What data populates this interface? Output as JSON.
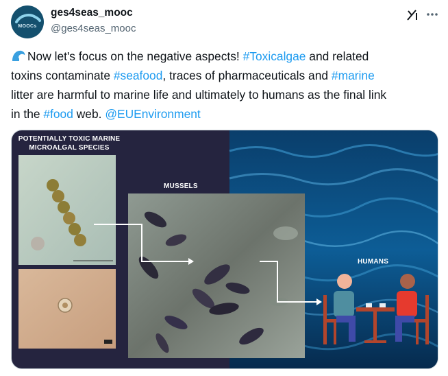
{
  "author": {
    "display_name": "ges4seas_mooc",
    "handle": "@ges4seas_mooc",
    "avatar_label": "MOOCs"
  },
  "tweet": {
    "line1": {
      "t1": "Now let's focus on the negative aspects! ",
      "h1": "#Toxicalgae",
      "t2": " and related"
    },
    "line2": {
      "t1": "toxins contaminate ",
      "h1": "#seafood",
      "t2": ", traces of pharmaceuticals and ",
      "h2": "#marine"
    },
    "line3": {
      "t1": "litter are harmful to marine life and ultimately to humans as the final link"
    },
    "line4": {
      "t1": "in the ",
      "h1": "#food",
      "t2": " web. ",
      "m1": "@EUEnvironment"
    }
  },
  "media": {
    "species_label_1": "POTENTIALLY TOXIC MARINE",
    "species_label_2": "MICROALGAL SPECIES",
    "mussels_label": "MUSSELS",
    "humans_label": "HUMANS"
  },
  "icons": [
    "wave-emoji-icon",
    "grok-icon",
    "more-options-icon",
    "arrow-icon",
    "person-icon",
    "table-icon",
    "chair-icon",
    "cup-icon"
  ],
  "colors": {
    "link": "#1d9bf0",
    "text": "#0f1419",
    "secondary_text": "#536471",
    "panel_dark": "#25243f",
    "avatar_bg": "#14506e",
    "person_left_shirt": "#4f8ea0",
    "person_right_shirt": "#e63a2e",
    "furniture": "#b2452c",
    "pants": "#3f4aa8"
  }
}
